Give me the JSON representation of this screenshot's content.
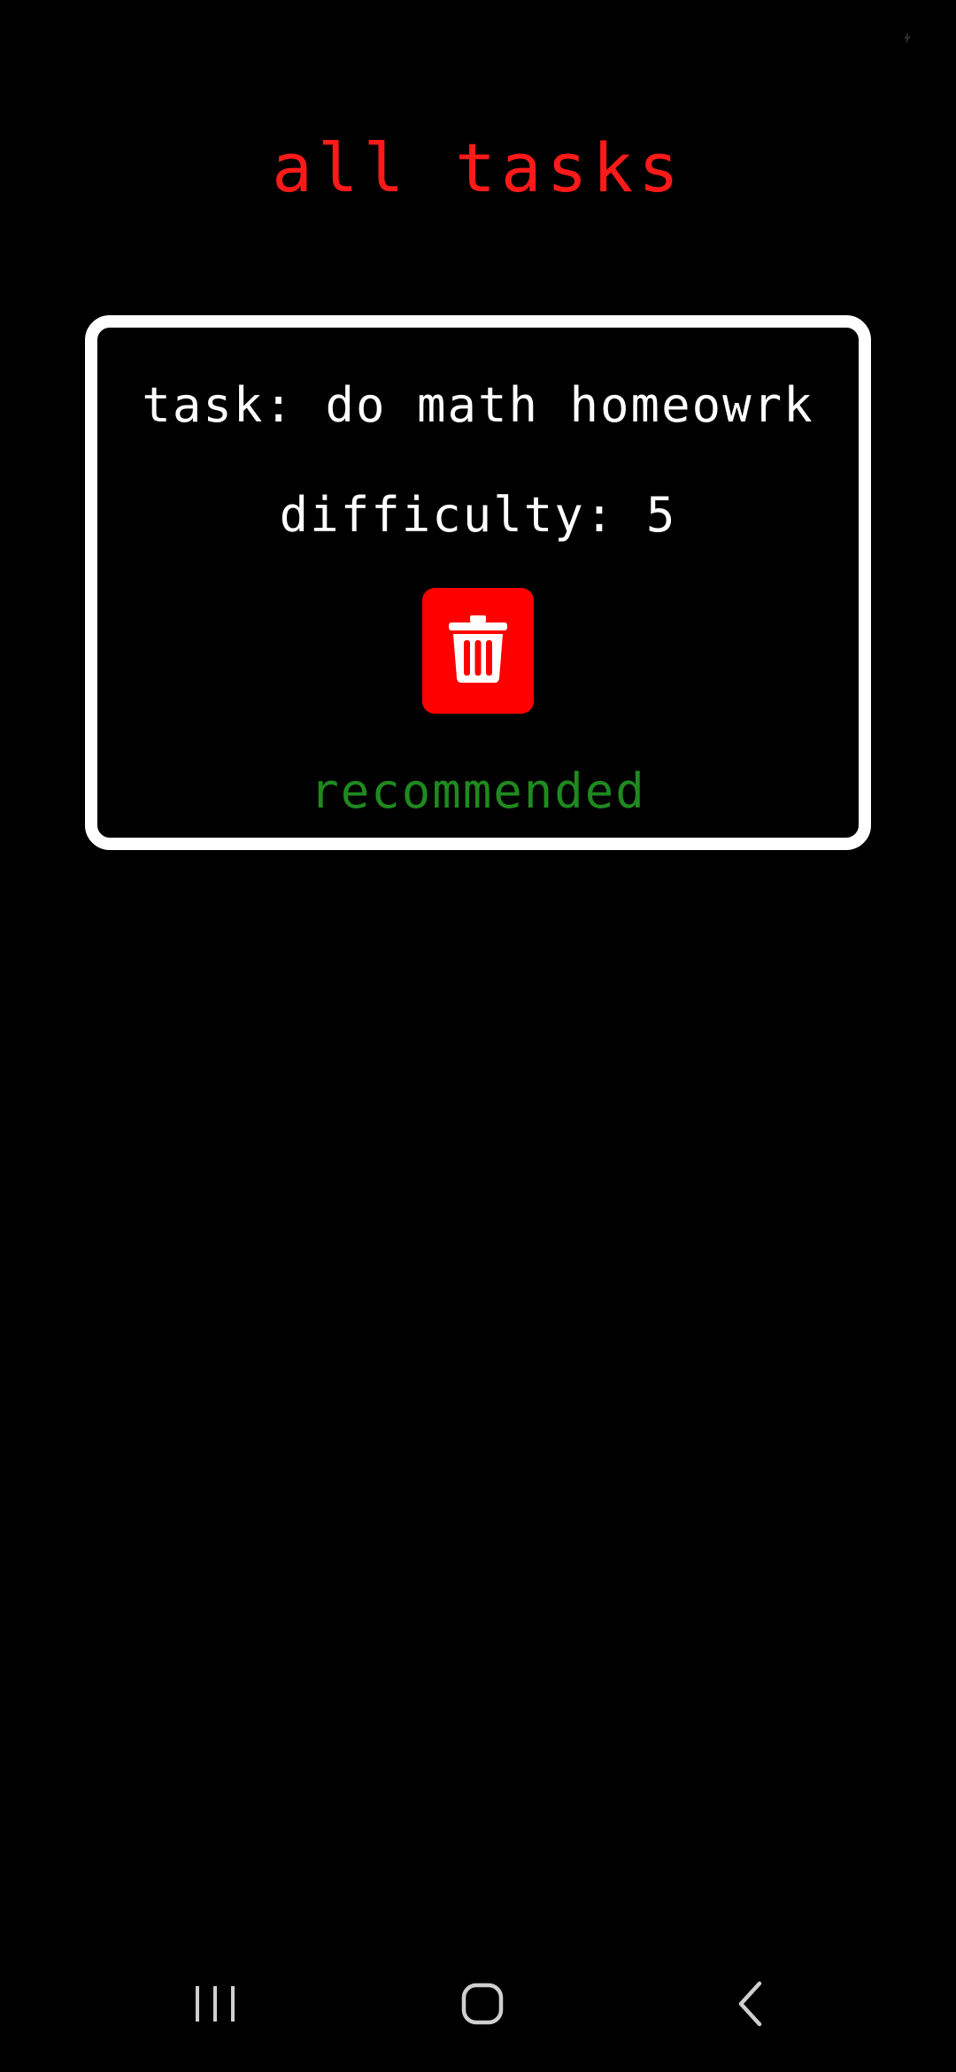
{
  "title": "all tasks",
  "task_card": {
    "task_label": "task:",
    "task_value": "do math homeowrk",
    "difficulty_label": "difficulty:",
    "difficulty_value": "5",
    "status_text": "recommended",
    "delete_icon": "trash-icon"
  },
  "nav_bar": {
    "recents_icon": "recents-icon",
    "home_icon": "home-icon",
    "back_icon": "back-icon"
  },
  "colors": {
    "background": "#000000",
    "title": "#ff1a1a",
    "card_border": "#ffffff",
    "text": "#ffffff",
    "delete_button": "#ff0000",
    "recommended": "#1f8a1f"
  }
}
